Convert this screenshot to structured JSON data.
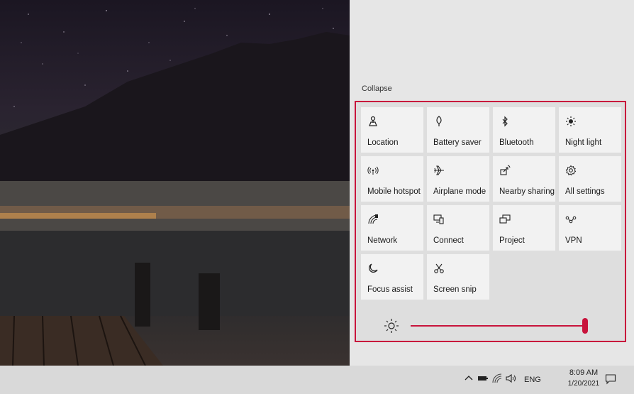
{
  "action_center": {
    "collapse_label": "Collapse",
    "tiles": [
      {
        "label": "Location",
        "icon": "location-icon"
      },
      {
        "label": "Battery saver",
        "icon": "battery-saver-icon"
      },
      {
        "label": "Bluetooth",
        "icon": "bluetooth-icon"
      },
      {
        "label": "Night light",
        "icon": "night-light-icon"
      },
      {
        "label": "Mobile hotspot",
        "icon": "mobile-hotspot-icon"
      },
      {
        "label": "Airplane mode",
        "icon": "airplane-icon"
      },
      {
        "label": "Nearby sharing",
        "icon": "nearby-sharing-icon"
      },
      {
        "label": "All settings",
        "icon": "gear-icon"
      },
      {
        "label": "Network",
        "icon": "network-icon"
      },
      {
        "label": "Connect",
        "icon": "connect-icon"
      },
      {
        "label": "Project",
        "icon": "project-icon"
      },
      {
        "label": "VPN",
        "icon": "vpn-icon"
      },
      {
        "label": "Focus assist",
        "icon": "moon-icon"
      },
      {
        "label": "Screen snip",
        "icon": "screen-snip-icon"
      }
    ],
    "brightness": {
      "icon": "brightness-icon",
      "level": 1.0
    }
  },
  "taskbar": {
    "tray_icons": [
      "chevron-up-icon",
      "battery-icon",
      "wifi-icon",
      "speaker-icon"
    ],
    "language": "ENG",
    "time": "8:09 AM",
    "date": "1/20/2021",
    "notification_icon": "notification-icon"
  },
  "colors": {
    "accent": "#c8143c",
    "tile_bg": "#f2f2f2",
    "panel_bg": "#dedede",
    "taskbar_bg": "#d9d9d9"
  }
}
